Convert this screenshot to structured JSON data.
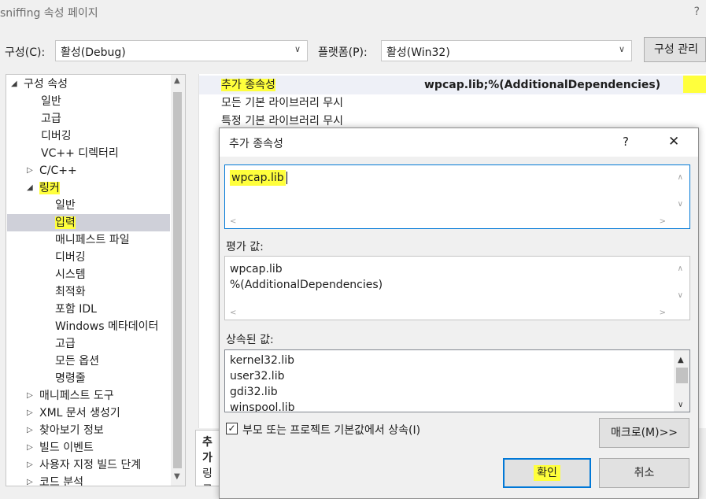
{
  "window": {
    "title": "sniffing 속성 페이지",
    "help": "?"
  },
  "toolbar": {
    "config_label": "구성(C):",
    "config_value": "활성(Debug)",
    "platform_label": "플랫폼(P):",
    "platform_value": "활성(Win32)",
    "config_manager": "구성 관리"
  },
  "tree": {
    "root": "구성 속성",
    "items": [
      "일반",
      "고급",
      "디버깅",
      "VC++ 디렉터리",
      "C/C++",
      "링커"
    ],
    "linker_children": [
      "일반",
      "입력",
      "매니페스트 파일",
      "디버깅",
      "시스템",
      "최적화",
      "포함 IDL",
      "Windows 메타데이터",
      "고급",
      "모든 옵션",
      "명령줄"
    ],
    "after": [
      "매니페스트 도구",
      "XML 문서 생성기",
      "찾아보기 정보",
      "빌드 이벤트",
      "사용자 지정 빌드 단계",
      "코드 분석"
    ]
  },
  "grid": {
    "rows": [
      {
        "name": "추가 종속성",
        "value": "wpcap.lib;%(AdditionalDependencies)"
      },
      {
        "name": "모든 기본 라이브러리 무시",
        "value": ""
      },
      {
        "name": "특정 기본 라이브러리 무시",
        "value": ""
      }
    ]
  },
  "description": {
    "title": "추가",
    "text": "링크"
  },
  "dialog": {
    "title": "추가 종속성",
    "help": "?",
    "close": "✕",
    "input_value": "wpcap.lib",
    "evaluated_label": "평가 값:",
    "evaluated_lines": [
      "wpcap.lib",
      "%(AdditionalDependencies)"
    ],
    "inherited_label": "상속된 값:",
    "inherited_lines": [
      "kernel32.lib",
      "user32.lib",
      "gdi32.lib",
      "winspool.lib"
    ],
    "inherit_checkbox": "부모 또는 프로젝트 기본값에서 상속(I)",
    "macro_button": "매크로(M)>>",
    "ok_button": "확인",
    "cancel_button": "취소"
  }
}
